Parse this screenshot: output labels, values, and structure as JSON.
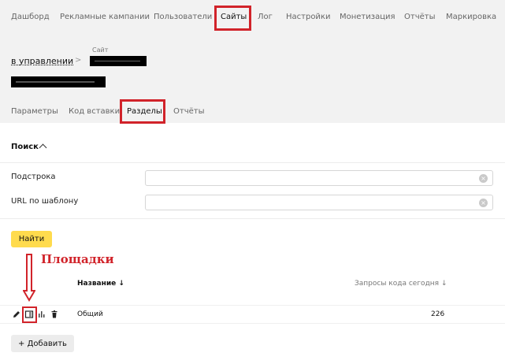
{
  "topnav": {
    "items": [
      "Дашборд",
      "Рекламные кампании",
      "Пользователи",
      "Сайты",
      "Лог",
      "Настройки",
      "Монетизация",
      "Отчёты",
      "Маркировка"
    ],
    "active": "Сайты"
  },
  "breadcrumb": {
    "link": "в управлении",
    "separator": ">",
    "current_label": "Сайт"
  },
  "tabs": {
    "items": [
      "Параметры",
      "Код вставки",
      "Разделы",
      "Отчёты"
    ],
    "active": "Разделы"
  },
  "search": {
    "title": "Поиск",
    "fields": [
      {
        "label": "Подстрока",
        "value": "",
        "placeholder": ""
      },
      {
        "label": "URL по шаблону",
        "value": "",
        "placeholder": ""
      }
    ],
    "submit_label": "Найти"
  },
  "annotation": {
    "text": "Площадки",
    "color": "#d1232a"
  },
  "table": {
    "columns": [
      "Название ↓",
      "Запросы кода сегодня ↓"
    ],
    "rows": [
      {
        "name": "Общий",
        "requests_today": "226",
        "actions": [
          "edit-icon",
          "pads-icon",
          "stats-icon",
          "delete-icon"
        ]
      }
    ]
  },
  "add_button_label": "+ Добавить",
  "colors": {
    "accent": "#ffdb4d",
    "highlight": "#d1232a",
    "header_bg": "#f2f2f2"
  }
}
